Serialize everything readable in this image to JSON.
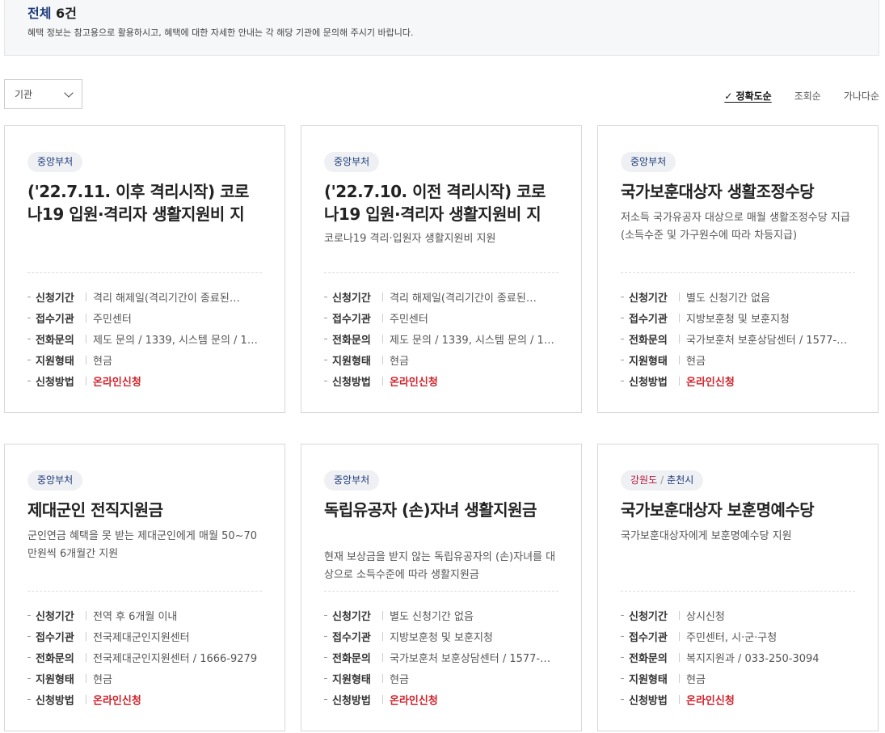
{
  "summary": {
    "title_prefix": "전체",
    "count": "6건",
    "description": "혜택 정보는 참고용으로 활용하시고, 혜택에 대한 자세한 안내는 각 해당 기관에 문의해 주시기 바랍니다."
  },
  "filter": {
    "selected": "기관"
  },
  "sort": {
    "accuracy": "✓ 정확도순",
    "views": "조회순",
    "alphabetical": "가나다순"
  },
  "labels": {
    "apply_period": "신청기간",
    "agency": "접수기관",
    "phone": "전화문의",
    "support_type": "지원형태",
    "apply_method": "신청방법"
  },
  "cards": [
    {
      "badge": "중앙부처",
      "title": "('22.7.11. 이후 격리시작) 코로나19 입원·격리자 생활지원비 지",
      "desc": "",
      "apply_period": "격리 해제일(격리기간이 종료된…",
      "agency": "주민센터",
      "phone": "제도 문의 / 1339, 시스템 문의 / 1…",
      "support_type": "현금",
      "apply_method": "온라인신청"
    },
    {
      "badge": "중앙부처",
      "title": "('22.7.10. 이전 격리시작) 코로나19 입원·격리자 생활지원비 지",
      "desc": "코로나19 격리·입원자 생활지원비 지원",
      "apply_period": "격리 해제일(격리기간이 종료된…",
      "agency": "주민센터",
      "phone": "제도 문의 / 1339, 시스템 문의 / 1…",
      "support_type": "현금",
      "apply_method": "온라인신청"
    },
    {
      "badge": "중앙부처",
      "title": "국가보훈대상자 생활조정수당",
      "desc": "저소득 국가유공자 대상으로 매월 생활조정수당 지급 (소득수준 및 가구원수에 따라 차등지급)",
      "apply_period": "별도 신청기간 없음",
      "agency": "지방보훈청 및 보훈지청",
      "phone": "국가보훈처 보훈상담센터 / 1577-…",
      "support_type": "현금",
      "apply_method": "온라인신청"
    },
    {
      "badge": "중앙부처",
      "title": "제대군인 전직지원금",
      "desc": "군인연금 혜택을 못 받는 제대군인에게 매월 50~70만원씩 6개월간 지원",
      "apply_period": "전역 후 6개월 이내",
      "agency": "전국제대군인지원센터",
      "phone": "전국제대군인지원센터 / 1666-9279",
      "support_type": "현금",
      "apply_method": "온라인신청"
    },
    {
      "badge": "중앙부처",
      "title": "독립유공자 (손)자녀 생활지원금",
      "desc": "현재 보상금을 받지 않는 독립유공자의 (손)자녀를 대상으로 소득수준에 따라 생활지원금",
      "apply_period": "별도 신청기간 없음",
      "agency": "지방보훈청 및 보훈지청",
      "phone": "국가보훈처 보훈상담센터 / 1577-…",
      "support_type": "현금",
      "apply_method": "온라인신청"
    },
    {
      "badge_region": "강원도",
      "badge_sep": "/",
      "badge": "춘천시",
      "title": "국가보훈대상자 보훈명예수당",
      "desc": "국가보훈대상자에게 보훈명예수당 지원",
      "apply_period": "상시신청",
      "agency": "주민센터, 시·군·구청",
      "phone": "복지지원과 / 033-250-3094",
      "support_type": "현금",
      "apply_method": "온라인신청"
    }
  ]
}
